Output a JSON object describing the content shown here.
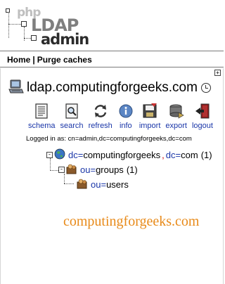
{
  "logo": {
    "php": "php",
    "ldap": "LDAP",
    "admin": "admin"
  },
  "topnav": {
    "home": "Home",
    "separator": "|",
    "purge": "Purge caches"
  },
  "server": {
    "name": "ldap.computingforgeeks.com"
  },
  "toolbar": [
    {
      "label": "schema",
      "icon": "schema-icon"
    },
    {
      "label": "search",
      "icon": "search-icon"
    },
    {
      "label": "refresh",
      "icon": "refresh-icon"
    },
    {
      "label": "info",
      "icon": "info-icon"
    },
    {
      "label": "import",
      "icon": "import-icon"
    },
    {
      "label": "export",
      "icon": "export-icon"
    },
    {
      "label": "logout",
      "icon": "logout-icon"
    }
  ],
  "logged_in": "Logged in as: cn=admin,dc=computingforgeeks,dc=com",
  "tree": {
    "root": {
      "attr1": "dc",
      "val1": "computingforgeeks",
      "attr2": "dc",
      "val2": "com",
      "count": "(1)"
    },
    "groups": {
      "attr": "ou",
      "val": "groups",
      "count": "(1)"
    },
    "users": {
      "attr": "ou",
      "val": "users"
    }
  },
  "watermark": "computingforgeeks.com"
}
